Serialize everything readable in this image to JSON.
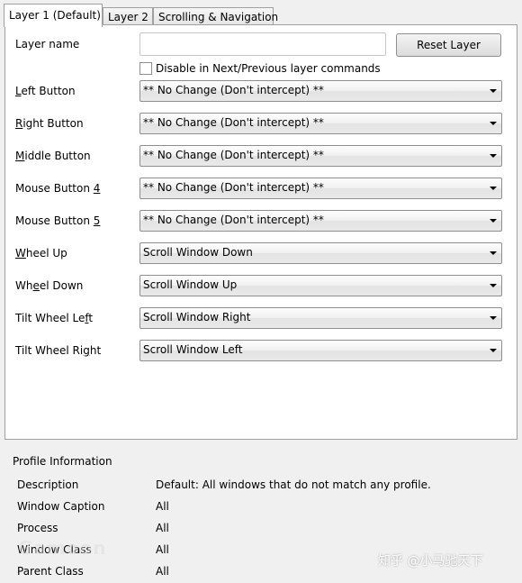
{
  "tabs": [
    {
      "label": "Layer 1 (Default)",
      "active": true
    },
    {
      "label": "Layer 2",
      "active": false
    },
    {
      "label": "Scrolling & Navigation",
      "active": false
    }
  ],
  "layer": {
    "name_label": "Layer name",
    "name_value": "",
    "reset_label": "Reset Layer",
    "disable_label": "Disable in Next/Previous layer commands",
    "disable_checked": false
  },
  "buttons": [
    {
      "pre": "",
      "key": "L",
      "post": "eft Button",
      "value": "** No Change (Don't intercept) **"
    },
    {
      "pre": "",
      "key": "R",
      "post": "ight Button",
      "value": "** No Change (Don't intercept) **"
    },
    {
      "pre": "",
      "key": "M",
      "post": "iddle Button",
      "value": "** No Change (Don't intercept) **"
    },
    {
      "pre": "Mouse Button ",
      "key": "4",
      "post": "",
      "value": "** No Change (Don't intercept) **"
    },
    {
      "pre": "Mouse Button ",
      "key": "5",
      "post": "",
      "value": "** No Change (Don't intercept) **"
    },
    {
      "pre": "",
      "key": "W",
      "post": "heel Up",
      "value": "Scroll Window Down"
    },
    {
      "pre": "Wh",
      "key": "e",
      "post": "el Down",
      "value": "Scroll Window Up"
    },
    {
      "pre": "Tilt Wheel Le",
      "key": "f",
      "post": "t",
      "value": "Scroll Window Right"
    },
    {
      "pre": "Tilt Wheel Ri",
      "key": "g",
      "post": "ht",
      "value": "Scroll Window Left"
    }
  ],
  "profile": {
    "title": "Profile Information",
    "rows": [
      {
        "label": "Description",
        "value": "Default: All windows that do not match any profile."
      },
      {
        "label": "Window Caption",
        "value": "All"
      },
      {
        "label": "Process",
        "value": "All"
      },
      {
        "label": "Window Class",
        "value": "All"
      },
      {
        "label": "Parent Class",
        "value": "All"
      }
    ]
  },
  "watermarks": {
    "left": "Gamoon",
    "right": "知乎 @小马驰天下"
  }
}
